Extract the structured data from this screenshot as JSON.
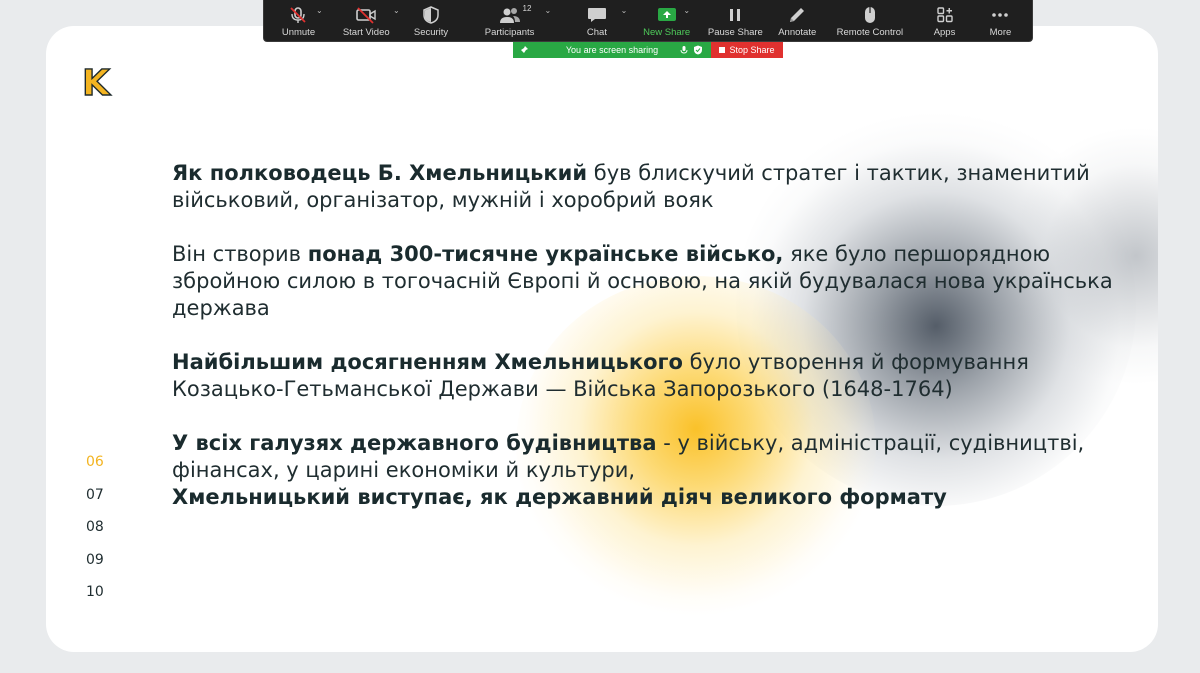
{
  "toolbar": {
    "buttons": [
      {
        "label": "Unmute",
        "icon": "mic-muted-icon",
        "caret": true
      },
      {
        "label": "Start Video",
        "icon": "video-off-icon",
        "caret": true
      },
      {
        "label": "Security",
        "icon": "shield-icon",
        "caret": false
      },
      {
        "label": "Participants",
        "icon": "participants-icon",
        "caret": true,
        "count": "12"
      },
      {
        "label": "Chat",
        "icon": "chat-icon",
        "caret": true
      },
      {
        "label": "New Share",
        "icon": "share-screen-icon",
        "caret": true,
        "color": "#4ecb5a"
      },
      {
        "label": "Pause Share",
        "icon": "pause-icon",
        "caret": false
      },
      {
        "label": "Annotate",
        "icon": "pencil-icon",
        "caret": false
      },
      {
        "label": "Remote Control",
        "icon": "mouse-icon",
        "caret": false
      },
      {
        "label": "Apps",
        "icon": "apps-icon",
        "caret": false
      },
      {
        "label": "More",
        "icon": "more-icon",
        "caret": false
      }
    ]
  },
  "share_bar": {
    "status": "You are screen sharing",
    "stop": "Stop Share",
    "status_color": "#29a844",
    "stop_color": "#e0312f"
  },
  "slide": {
    "logo": "K",
    "accent_color": "#f3b421",
    "paragraphs": [
      {
        "bold": "Як полководець Б. Хмельницький",
        "text": " був блискучий стратег і тактик, знаменитий військовий, організатор, мужній і хоробрий вояк"
      },
      {
        "pre": "Він створив ",
        "bold": "понад 300-тисячне українське військо,",
        "text": " яке було першорядною збройною силою в тогочасній Європі й основою, на якій будувалася нова українська держава"
      },
      {
        "bold": "Найбільшим досягненням Хмельницького",
        "text": " було утворення й формування Козацько-Гетьманської Держави — Війська Запорозького (1648-1764)"
      },
      {
        "bold": "У всіх галузях державного будівництва",
        "text": " - у війську, адміністрації, судівництві, фінансах, у царині економіки й культури,",
        "bold2": "Хмельницький виступає, як державний діяч великого формату"
      }
    ],
    "pages": [
      "06",
      "07",
      "08",
      "09",
      "10"
    ],
    "active_page": "06"
  }
}
